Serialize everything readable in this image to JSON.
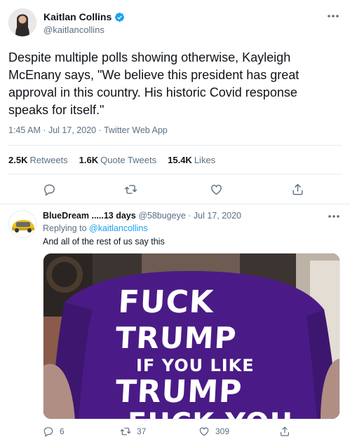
{
  "main": {
    "display_name": "Kaitlan Collins",
    "handle": "@kaitlancollins",
    "text": "Despite multiple polls showing otherwise, Kayleigh McEnany says, \"We believe this president has great approval in this country. His historic Covid response speaks for itself.\"",
    "meta": "1:45 AM · Jul 17, 2020 · Twitter Web App",
    "stats": {
      "retweets_num": "2.5K",
      "retweets_label": "Retweets",
      "quotes_num": "1.6K",
      "quotes_label": "Quote Tweets",
      "likes_num": "15.4K",
      "likes_label": "Likes"
    }
  },
  "reply": {
    "display_name": "BlueDream .....13 days",
    "handle_date": "@58bugeye · Jul 17, 2020",
    "replying_prefix": "Replying to ",
    "replying_to": "@kaitlancollins",
    "text": "And all of the rest of us say this",
    "shirt": {
      "line1": "FUCK",
      "line2": "TRUMP",
      "line3": "IF YOU LIKE",
      "line4": "TRUMP",
      "line5": "FUCK YOU"
    },
    "counts": {
      "replies": "6",
      "retweets": "37",
      "likes": "309"
    }
  },
  "icons": {
    "more": "more-horizontal-icon",
    "verified": "verified-badge-icon",
    "reply": "reply-icon",
    "retweet": "retweet-icon",
    "like": "heart-icon",
    "share": "share-icon"
  },
  "colors": {
    "accent": "#1da1f2",
    "secondary_text": "#5b7083",
    "divider": "#e6ecf0",
    "shirt": "#4b1d86"
  }
}
